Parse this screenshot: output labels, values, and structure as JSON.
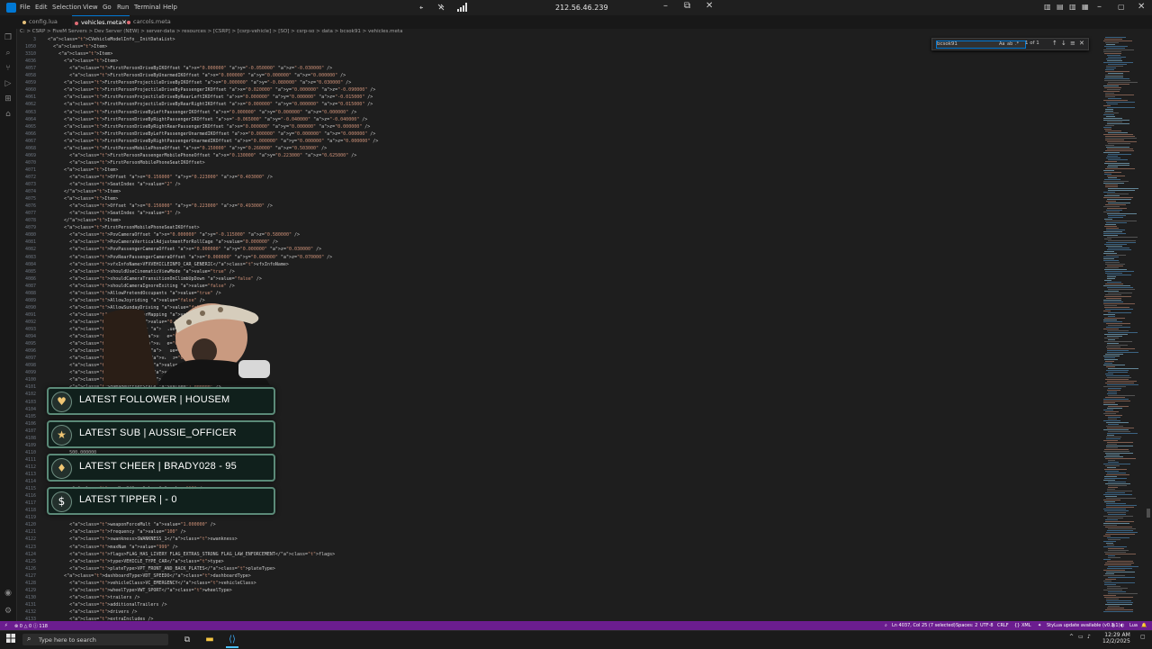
{
  "titlebar": {
    "menu": [
      "File",
      "Edit",
      "Selection",
      "View",
      "Go",
      "Run",
      "Terminal",
      "Help"
    ],
    "remote_ip": "212.56.46.239"
  },
  "tabs": [
    {
      "label": "config.lua",
      "color": "#e5c07b",
      "active": false
    },
    {
      "label": "vehicles.meta",
      "color": "#e06c75",
      "active": true
    },
    {
      "label": "carcols.meta",
      "color": "#e06c75",
      "active": false
    }
  ],
  "breadcrumb": "C: > CSRP > FiveM Servers > Dev Server (NEW) > server-data > resources > [CSRP] > [csrp-vehicle] > [SO] > csrp-so > data > bcsok91 > vehicles.meta",
  "editor": {
    "sticky_lines": [
      {
        "num": "3",
        "text": "<CVehicleModelInfo__InitDataList>"
      },
      {
        "num": "1050",
        "text": "  <Item>"
      },
      {
        "num": "3310",
        "text": "    <Item>"
      },
      {
        "num": "4036",
        "text": "      <Item>"
      }
    ],
    "lines": [
      {
        "num": "4057",
        "text": "        <FirstPersonDriveByIKOffset x=\"0.000000\" y=\"-0.050000\" z=\"-0.030000\" />"
      },
      {
        "num": "4058",
        "text": "        <FirstPersonDriveByUnarmedIKOffset x=\"0.000000\" y=\"0.000000\" z=\"0.000000\" />"
      },
      {
        "num": "4059",
        "text": "      <FirstPersonProjectileDriveByIKOffset x=\"0.000000\" y=\"-0.080000\" z=\"0.030000\" />"
      },
      {
        "num": "4060",
        "text": "      <FirstPersonProjectileDriveByPassengerIKOffset x=\"0.020000\" y=\"0.000000\" z=\"-0.090000\" />"
      },
      {
        "num": "4061",
        "text": "      <FirstPersonProjectileDriveByRearLeftIKOffset x=\"0.000000\" y=\"0.000000\" z=\"-0.015000\" />"
      },
      {
        "num": "4062",
        "text": "      <FirstPersonProjectileDriveByRearRightIKOffset x=\"0.000000\" y=\"0.000000\" z=\"0.015000\" />"
      },
      {
        "num": "4063",
        "text": "      <FirstPersonDriveByLeftPassengerIKOffset x=\"0.000000\" y=\"0.000000\" z=\"0.000000\" />"
      },
      {
        "num": "4064",
        "text": "      <FirstPersonDriveByRightPassengerIKOffset x=\"-0.065000\" y=\"-0.040000\" z=\"-0.040000\" />"
      },
      {
        "num": "4065",
        "text": "      <FirstPersonDriveByRightRearPassengerIKOffset x=\"0.000000\" y=\"0.000000\" z=\"0.000000\" />"
      },
      {
        "num": "4066",
        "text": "      <FirstPersonDriveByLeftPassengerUnarmedIKOffset x=\"0.000000\" y=\"0.000000\" z=\"0.000000\" />"
      },
      {
        "num": "4067",
        "text": "      <FirstPersonDriveByRightPassengerUnarmedIKOffset x=\"0.000000\" y=\"0.000000\" z=\"0.000000\" />"
      },
      {
        "num": "4068",
        "text": "      <FirstPersonMobilePhoneOffset x=\"0.150000\" y=\"0.260000\" z=\"0.503000\" />"
      },
      {
        "num": "4069",
        "text": "        <FirstPersonPassengerMobilePhoneOffset x=\"0.130000\" y=\"0.223000\" z=\"0.625000\" />"
      },
      {
        "num": "4070",
        "text": "        <FirstPersonMobilePhoneSeatIKOffset>"
      },
      {
        "num": "4071",
        "text": "      <Item>"
      },
      {
        "num": "4072",
        "text": "        <Offset x=\"0.156000\" y=\"0.223000\" z=\"0.403000\" />"
      },
      {
        "num": "4073",
        "text": "        <SeatIndex value=\"2\" />"
      },
      {
        "num": "4074",
        "text": "      </Item>"
      },
      {
        "num": "4075",
        "text": "      <Item>"
      },
      {
        "num": "4076",
        "text": "        <Offset x=\"0.156000\" y=\"0.223000\" z=\"0.493000\" />"
      },
      {
        "num": "4077",
        "text": "        <SeatIndex value=\"3\" />"
      },
      {
        "num": "4078",
        "text": "      </Item>"
      },
      {
        "num": "4079",
        "text": "      <FirstPersonMobilePhoneSeatIKOffset>"
      },
      {
        "num": "4080",
        "text": "        <PovCameraOffset x=\"0.000000\" y=\"-0.115000\" z=\"0.580000\" />"
      },
      {
        "num": "4081",
        "text": "        <PovCameraVerticalAdjustmentForRollCage value=\"0.000000\" />"
      },
      {
        "num": "4082",
        "text": "        <PovPassengerCameraOffset x=\"0.000000\" y=\"0.000000\" z=\"0.030000\" />"
      },
      {
        "num": "4083",
        "text": "        <PovRearPassengerCameraOffset x=\"0.000000\" y=\"0.000000\" z=\"0.070000\" />"
      },
      {
        "num": "4084",
        "text": "        <vfxInfoName>VFXVEHICLEINFO_CAR_GENERIC</vfxInfoName>"
      },
      {
        "num": "4085",
        "text": "        <shouldUseCinematicViewMode value=\"true\" />"
      },
      {
        "num": "4086",
        "text": "        <shouldCameraTransitionOnClimbUpDown value=\"false\" />"
      },
      {
        "num": "4087",
        "text": "        <shouldCameraIgnoreExiting value=\"false\" />"
      },
      {
        "num": "4088",
        "text": "        <AllowPretendOccupants value=\"true\" />"
      },
      {
        "num": "4089",
        "text": "        <AllowJoyriding value=\"false\" />"
      },
      {
        "num": "4090",
        "text": "        <AllowSundayDriving value=\"false\" />"
      },
      {
        "num": "4091",
        "text": "        <AllowBodyColorMapping value=\"true\" />"
      },
      {
        "num": "4092",
        "text": "        <wheelScale value=\"0.000000\" />"
      },
      {
        "num": "4093",
        "text": "        <wheelScaleRear value=\"0.000000\" />"
      },
      {
        "num": "4094",
        "text": "        <dirtLevelMin value=\"0.000000\" />"
      },
      {
        "num": "4095",
        "text": "        <dirtLevelMax value=\"0.000000\" />"
      },
      {
        "num": "4096",
        "text": "        <envEffScaleMin value=\"0.000000\" />"
      },
      {
        "num": "4097",
        "text": "        <envEffScaleMax value=\"0.000000\" />"
      },
      {
        "num": "4098",
        "text": "        <envEffScaleMin2 value=\"0.000000\" />"
      },
      {
        "num": "4099",
        "text": "        <envEffScaleMax2 value=\"0.000000\" />"
      },
      {
        "num": "4100",
        "text": "        <damageMapScale value=\"0.000000\" />"
      },
      {
        "num": "4101",
        "text": "        <damageOffsetScale value=\"1.000000\" />"
      },
      {
        "num": "4102",
        "text": ""
      },
      {
        "num": "4103",
        "text": ""
      },
      {
        "num": "4104",
        "text": ""
      },
      {
        "num": "4105",
        "text": ""
      },
      {
        "num": "4106",
        "text": ""
      },
      {
        "num": "4107",
        "text": ""
      },
      {
        "num": "4108",
        "text": ""
      },
      {
        "num": "4109",
        "text": ""
      },
      {
        "num": "4110",
        "text": "        500.000000"
      },
      {
        "num": "4111",
        "text": ""
      },
      {
        "num": "4112",
        "text": ""
      },
      {
        "num": "4113",
        "text": ""
      },
      {
        "num": "4114",
        "text": ""
      },
      {
        "num": "4115",
        "text": "        <maxNumOfSameColor value=\"10\" />"
      },
      {
        "num": "4116",
        "text": ""
      },
      {
        "num": "4117",
        "text": ""
      },
      {
        "num": "4118",
        "text": ""
      },
      {
        "num": "4119",
        "text": ""
      },
      {
        "num": "4120",
        "text": "        <weaponForceMult value=\"1.000000\" />"
      },
      {
        "num": "4121",
        "text": "        <frequency value=\"100\" />"
      },
      {
        "num": "4122",
        "text": "        <swankness>SWANKNESS_1</swankness>"
      },
      {
        "num": "4123",
        "text": "        <maxNum value=\"999\" />"
      },
      {
        "num": "4124",
        "text": "        <flags>FLAG_HAS_LIVERY FLAG_EXTRAS_STRONG FLAG_LAW_ENFORCEMENT</flags>"
      },
      {
        "num": "4125",
        "text": "        <type>VEHICLE_TYPE_CAR</type>"
      },
      {
        "num": "4126",
        "text": "        <plateType>VPT_FRONT_AND_BACK_PLATES</plateType>"
      },
      {
        "num": "4127",
        "text": "      <dashboardType>VDT_SPEEDO</dashboardType>"
      },
      {
        "num": "4128",
        "text": "        <vehicleClass>VC_EMERGENCY</vehicleClass>"
      },
      {
        "num": "4129",
        "text": "        <wheelType>VWT_SPORT</wheelType>"
      },
      {
        "num": "4130",
        "text": "        <trailers />"
      },
      {
        "num": "4131",
        "text": "        <additionalTrailers />"
      },
      {
        "num": "4132",
        "text": "        <drivers />"
      },
      {
        "num": "4133",
        "text": "        <extraIncludes />"
      },
      {
        "num": "4134",
        "text": "        <doorsWithCollisionWhenClosed />"
      }
    ]
  },
  "find_widget": {
    "query": "bcsok91",
    "count": "1 of 1"
  },
  "alerts": [
    {
      "icon": "heart-icon",
      "glyph": "♥",
      "text": "LATEST FOLLOWER | HOUSEM"
    },
    {
      "icon": "star-icon",
      "glyph": "★",
      "text": "LATEST SUB | AUSSIE_OFFICER"
    },
    {
      "icon": "diamond-icon",
      "glyph": "♦",
      "text": "LATEST CHEER | BRADY028 - 95"
    },
    {
      "icon": "dollar-icon",
      "glyph": "$",
      "text": "LATEST TIPPER |  - 0"
    }
  ],
  "statusbar": {
    "errors": "0",
    "warnings": "0",
    "info": "118",
    "cursor": "Ln 4037, Col 25 (7 selected)",
    "spaces": "Spaces: 2",
    "encoding": "UTF-8",
    "eol": "CRLF",
    "language": "XML",
    "notification": "StyLua update available (v0.3.1)",
    "lua": "Lua"
  },
  "taskbar": {
    "search_placeholder": "Type here to search",
    "time": "12:29 AM",
    "date": "12/2/2025"
  },
  "colors": {
    "statusbar": "#6b1d8f",
    "accent": "#0078d4",
    "alert_border": "#5b8a78"
  }
}
